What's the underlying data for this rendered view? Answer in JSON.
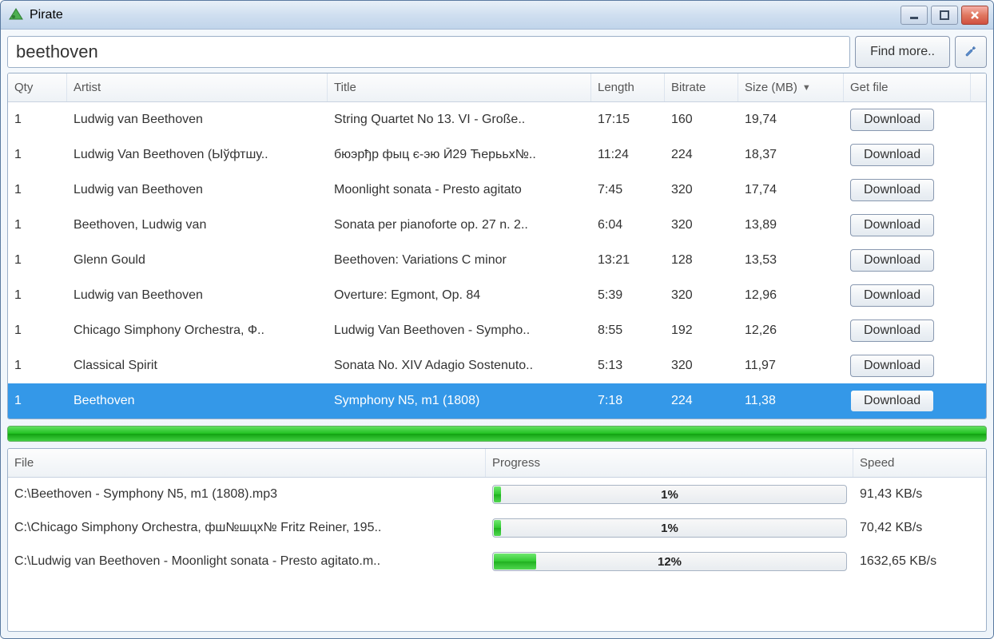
{
  "window": {
    "title": "Pirate"
  },
  "search": {
    "value": "beethoven",
    "find_more_label": "Find more.."
  },
  "results": {
    "columns": {
      "qty": "Qty",
      "artist": "Artist",
      "title": "Title",
      "length": "Length",
      "bitrate": "Bitrate",
      "size": "Size (MB)",
      "getfile": "Get file"
    },
    "sort_column": "size",
    "sort_dir": "desc",
    "download_label": "Download",
    "rows": [
      {
        "qty": "1",
        "artist": "Ludwig van Beethoven",
        "title": "String Quartet No 13. VI - Große..",
        "length": "17:15",
        "bitrate": "160",
        "size": "19,74",
        "selected": false
      },
      {
        "qty": "1",
        "artist": "Ludwig Van Beethoven (Ыўфтшу..",
        "title": "бюэрђр фыц є-эю Й29 Ћерььх№..",
        "length": "11:24",
        "bitrate": "224",
        "size": "18,37",
        "selected": false
      },
      {
        "qty": "1",
        "artist": "Ludwig van Beethoven",
        "title": "Moonlight sonata - Presto agitato",
        "length": "7:45",
        "bitrate": "320",
        "size": "17,74",
        "selected": false
      },
      {
        "qty": "1",
        "artist": "Beethoven, Ludwig van",
        "title": "Sonata per pianoforte op. 27 n. 2..",
        "length": "6:04",
        "bitrate": "320",
        "size": "13,89",
        "selected": false
      },
      {
        "qty": "1",
        "artist": "Glenn Gould",
        "title": "Beethoven: Variations C minor",
        "length": "13:21",
        "bitrate": "128",
        "size": "13,53",
        "selected": false
      },
      {
        "qty": "1",
        "artist": "Ludwig van Beethoven",
        "title": "Overture: Egmont, Op. 84",
        "length": "5:39",
        "bitrate": "320",
        "size": "12,96",
        "selected": false
      },
      {
        "qty": "1",
        "artist": "Chicago Simphony Orchestra, Ф..",
        "title": "Ludwig Van Beethoven - Sympho..",
        "length": "8:55",
        "bitrate": "192",
        "size": "12,26",
        "selected": false
      },
      {
        "qty": "1",
        "artist": "Classical Spirit",
        "title": "Sonata No. XIV Adagio Sostenuto..",
        "length": "5:13",
        "bitrate": "320",
        "size": "11,97",
        "selected": false
      },
      {
        "qty": "1",
        "artist": "Beethoven",
        "title": "Symphony N5, m1 (1808)",
        "length": "7:18",
        "bitrate": "224",
        "size": "11,38",
        "selected": true
      }
    ]
  },
  "downloads": {
    "columns": {
      "file": "File",
      "progress": "Progress",
      "speed": "Speed"
    },
    "rows": [
      {
        "file": "C:\\Beethoven - Symphony N5, m1 (1808).mp3",
        "progress": 1,
        "progress_label": "1%",
        "speed": "91,43 KB/s"
      },
      {
        "file": "C:\\Chicago Simphony Orchestra, фш№шцх№ Fritz Reiner, 195..",
        "progress": 1,
        "progress_label": "1%",
        "speed": "70,42 KB/s"
      },
      {
        "file": "C:\\Ludwig van Beethoven - Moonlight sonata - Presto agitato.m..",
        "progress": 12,
        "progress_label": "12%",
        "speed": "1632,65 KB/s"
      }
    ]
  }
}
